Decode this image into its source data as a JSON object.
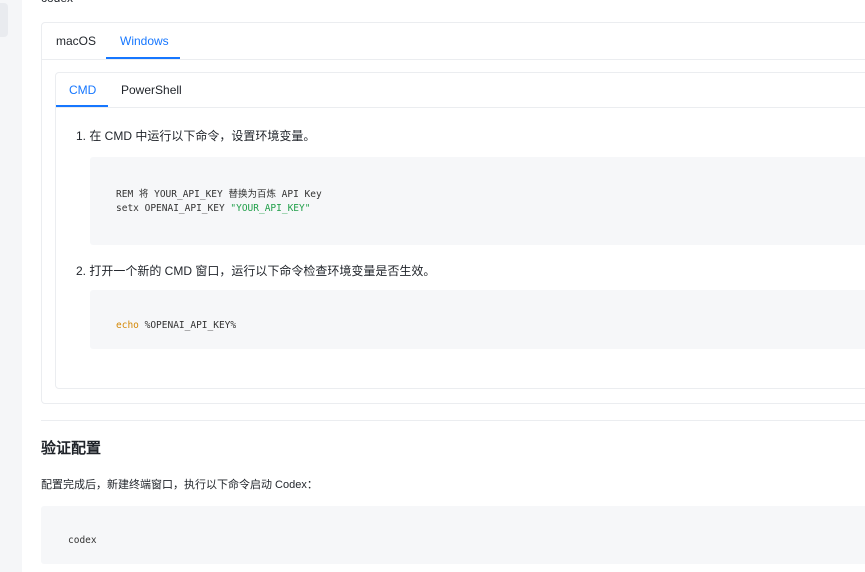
{
  "top_partial_text": "codex",
  "os_tabs": [
    {
      "label": "macOS",
      "active": false
    },
    {
      "label": "Windows",
      "active": true
    }
  ],
  "shell_tabs": [
    {
      "label": "CMD",
      "active": true
    },
    {
      "label": "PowerShell",
      "active": false
    }
  ],
  "steps": [
    {
      "text": "1. 在 CMD 中运行以下命令，设置环境变量。",
      "code": {
        "line1": "REM 将 YOUR_API_KEY 替换为百炼 API Key",
        "line2_cmd": "setx OPENAI_API_KEY ",
        "line2_str": "\"YOUR_API_KEY\""
      }
    },
    {
      "text": "2. 打开一个新的 CMD 窗口，运行以下命令检查环境变量是否生效。",
      "code": {
        "keyword": "echo",
        "rest": " %OPENAI_API_KEY%"
      }
    }
  ],
  "verify": {
    "title": "验证配置",
    "desc": "配置完成后，新建终端窗口，执行以下命令启动 Codex：",
    "code": "codex"
  },
  "colors": {
    "accent": "#1677ff",
    "string": "#22a04b",
    "keyword": "#d48806",
    "code_bg": "#f6f7f9"
  }
}
